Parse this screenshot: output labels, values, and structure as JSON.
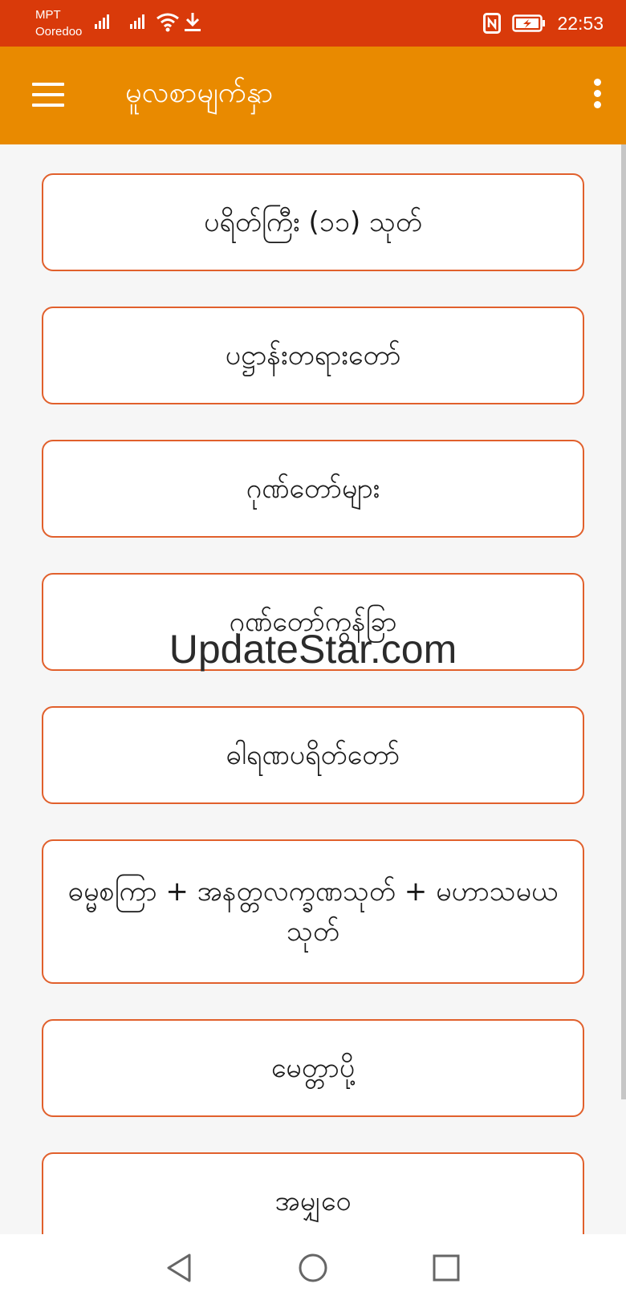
{
  "status": {
    "carrier_line1": "MPT",
    "carrier_line2": "Ooredoo",
    "time": "22:53",
    "icons": [
      "signal-icon",
      "signal-icon",
      "wifi-icon",
      "download-icon",
      "nfc-icon",
      "battery-charging-icon"
    ]
  },
  "appbar": {
    "title": "မူလစာမျက်နှာ",
    "color": "#e98a00"
  },
  "menu_items": [
    "ပရိတ်ကြီး (၁၁) သုတ်",
    "ပဋ္ဌာန်းတရားတော်",
    "ဂုဏ်တော်များ",
    "ဂုဏ်တော်ကွန်ခြာ",
    "ဓါရဏပရိတ်တော်",
    "ဓမ္မစကြာ + အနတ္တလက္ခဏသုတ် + မဟာသမယသုတ်",
    "မေတ္တာပို့",
    "အမျှဝေ"
  ],
  "watermark": "UpdateStar.com",
  "colors": {
    "status_bar": "#d93a0a",
    "button_border": "#e1602c"
  }
}
